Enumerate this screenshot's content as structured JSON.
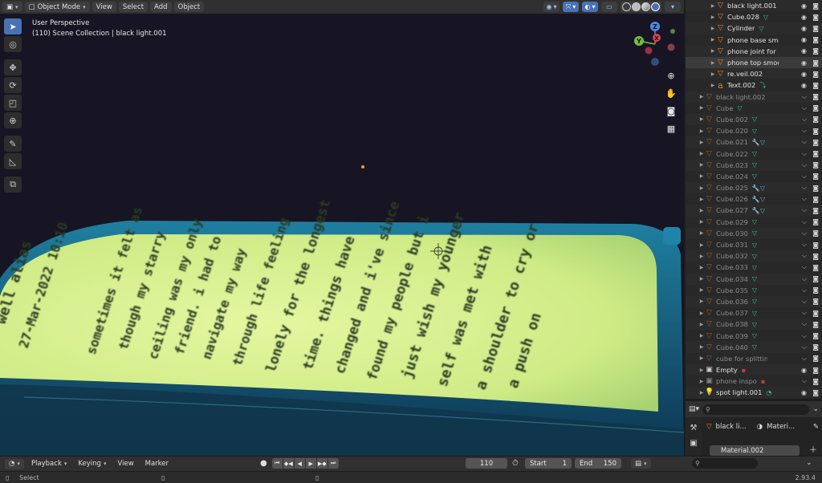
{
  "header": {
    "mode_label": "Object Mode",
    "menus": [
      "View",
      "Select",
      "Add",
      "Object"
    ]
  },
  "viewport": {
    "perspective_label": "User Perspective",
    "collection_label": "(110) Scene Collection | black light.001",
    "phone_screen_text": [
      "well alias",
      "27-Mar-2022 10:10",
      "sometimes it felt as",
      "though my starry",
      "ceiling was my only",
      "friend. i had to",
      "navigate my way",
      "through life feeling",
      "lonely for the longest",
      "time. things have",
      "changed and i've since",
      "found my people but i",
      "just wish my younger",
      "self was met with",
      "a shoulder to cry or",
      "a push on"
    ],
    "gizmo_axes": [
      "Z",
      "Y",
      "X"
    ]
  },
  "outliner": {
    "items": [
      {
        "label": "black light.001",
        "icon": "mesh-icon",
        "mod": "",
        "dim": false,
        "indent": 2,
        "sel": false
      },
      {
        "label": "Cube.028",
        "icon": "mesh-icon",
        "mod": "mesh-data-icon",
        "dim": false,
        "indent": 2,
        "sel": false
      },
      {
        "label": "Cylinder",
        "icon": "mesh-icon",
        "mod": "mesh-data-icon",
        "dim": false,
        "indent": 2,
        "sel": false
      },
      {
        "label": "phone base smo",
        "icon": "mesh-icon",
        "mod": "",
        "dim": false,
        "indent": 2,
        "sel": false
      },
      {
        "label": "phone joint for s",
        "icon": "mesh-icon",
        "mod": "",
        "dim": false,
        "indent": 2,
        "sel": false
      },
      {
        "label": "phone top smoo",
        "icon": "mesh-icon",
        "mod": "",
        "dim": false,
        "indent": 2,
        "sel": true
      },
      {
        "label": "re.veil.002",
        "icon": "mesh-icon",
        "mod": "",
        "dim": false,
        "indent": 2,
        "sel": false
      },
      {
        "label": "Text.002",
        "icon": "text-icon",
        "mod": "curve-icon",
        "dim": false,
        "indent": 2,
        "sel": false
      },
      {
        "label": "black light.002",
        "icon": "mesh-icon",
        "mod": "",
        "dim": true,
        "indent": 1,
        "sel": false
      },
      {
        "label": "Cube",
        "icon": "mesh-icon",
        "mod": "mesh-data-icon",
        "dim": true,
        "indent": 1,
        "sel": false
      },
      {
        "label": "Cube.002",
        "icon": "mesh-icon",
        "mod": "mesh-data-icon",
        "dim": true,
        "indent": 1,
        "sel": false
      },
      {
        "label": "Cube.020",
        "icon": "mesh-icon",
        "mod": "mesh-data-icon",
        "dim": true,
        "indent": 1,
        "sel": false
      },
      {
        "label": "Cube.021",
        "icon": "mesh-icon",
        "mod": "wrench-icon",
        "dim": true,
        "indent": 1,
        "sel": false
      },
      {
        "label": "Cube.022",
        "icon": "mesh-icon",
        "mod": "mesh-data-icon",
        "dim": true,
        "indent": 1,
        "sel": false
      },
      {
        "label": "Cube.023",
        "icon": "mesh-icon",
        "mod": "mesh-data-icon",
        "dim": true,
        "indent": 1,
        "sel": false
      },
      {
        "label": "Cube.024",
        "icon": "mesh-icon",
        "mod": "mesh-data-icon",
        "dim": true,
        "indent": 1,
        "sel": false
      },
      {
        "label": "Cube.025",
        "icon": "mesh-icon",
        "mod": "wrench-icon",
        "dim": true,
        "indent": 1,
        "sel": false
      },
      {
        "label": "Cube.026",
        "icon": "mesh-icon",
        "mod": "wrench-icon",
        "dim": true,
        "indent": 1,
        "sel": false
      },
      {
        "label": "Cube.027",
        "icon": "mesh-icon",
        "mod": "wrench-icon",
        "dim": true,
        "indent": 1,
        "sel": false
      },
      {
        "label": "Cube.029",
        "icon": "mesh-icon",
        "mod": "mesh-data-icon",
        "dim": true,
        "indent": 1,
        "sel": false
      },
      {
        "label": "Cube.030",
        "icon": "mesh-icon",
        "mod": "mesh-data-icon",
        "dim": true,
        "indent": 1,
        "sel": false
      },
      {
        "label": "Cube.031",
        "icon": "mesh-icon",
        "mod": "mesh-data-icon",
        "dim": true,
        "indent": 1,
        "sel": false
      },
      {
        "label": "Cube.032",
        "icon": "mesh-icon",
        "mod": "mesh-data-icon",
        "dim": true,
        "indent": 1,
        "sel": false
      },
      {
        "label": "Cube.033",
        "icon": "mesh-icon",
        "mod": "mesh-data-icon",
        "dim": true,
        "indent": 1,
        "sel": false
      },
      {
        "label": "Cube.034",
        "icon": "mesh-icon",
        "mod": "mesh-data-icon",
        "dim": true,
        "indent": 1,
        "sel": false
      },
      {
        "label": "Cube.035",
        "icon": "mesh-icon",
        "mod": "mesh-data-icon",
        "dim": true,
        "indent": 1,
        "sel": false
      },
      {
        "label": "Cube.036",
        "icon": "mesh-icon",
        "mod": "mesh-data-icon",
        "dim": true,
        "indent": 1,
        "sel": false
      },
      {
        "label": "Cube.037",
        "icon": "mesh-icon",
        "mod": "mesh-data-icon",
        "dim": true,
        "indent": 1,
        "sel": false
      },
      {
        "label": "Cube.038",
        "icon": "mesh-icon",
        "mod": "mesh-data-icon",
        "dim": true,
        "indent": 1,
        "sel": false
      },
      {
        "label": "Cube.039",
        "icon": "mesh-icon",
        "mod": "mesh-data-icon",
        "dim": true,
        "indent": 1,
        "sel": false
      },
      {
        "label": "Cube.040",
        "icon": "mesh-icon",
        "mod": "mesh-data-icon",
        "dim": true,
        "indent": 1,
        "sel": false
      },
      {
        "label": "cube for splitting",
        "icon": "mesh-icon",
        "mod": "",
        "dim": true,
        "indent": 1,
        "sel": false
      },
      {
        "label": "Empty",
        "icon": "empty-image-icon",
        "mod": "image-icon",
        "dim": false,
        "indent": 1,
        "sel": false
      },
      {
        "label": "phone inspo",
        "icon": "empty-image-icon",
        "mod": "image-icon",
        "dim": true,
        "indent": 1,
        "sel": false
      },
      {
        "label": "spot light.001",
        "icon": "light-icon",
        "mod": "light-data-icon",
        "dim": false,
        "indent": 1,
        "sel": false
      }
    ]
  },
  "properties": {
    "object_name": "black li...",
    "tab_label": "Materi...",
    "material_slot": "Material.002"
  },
  "timeline": {
    "menus": [
      "Playback",
      "Keying",
      "View",
      "Marker"
    ],
    "current_frame": "110",
    "start_label": "Start",
    "start_value": "1",
    "end_label": "End",
    "end_value": "150"
  },
  "status": {
    "left_label": "Select",
    "version": "2.93.4"
  },
  "colors": {
    "screen_glow": "#d4f08a",
    "phone_body": "#1b6c8a",
    "accent": "#4772b3",
    "mesh_icon": "#e38a3f",
    "data_icon": "#39c08c"
  }
}
